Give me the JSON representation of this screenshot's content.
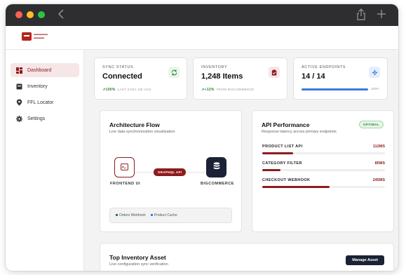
{
  "sidebar": {
    "items": [
      {
        "label": "Dashboard",
        "icon": "dashboard-icon",
        "active": true
      },
      {
        "label": "Inventory",
        "icon": "inventory-icon",
        "active": false
      },
      {
        "label": "FFL Locator",
        "icon": "location-pin-icon",
        "active": false
      },
      {
        "label": "Settings",
        "icon": "gear-icon",
        "active": false
      }
    ]
  },
  "stats": [
    {
      "label": "SYNC STATUS",
      "value": "Connected",
      "trend": "100%",
      "foot": "LAST SYNC 2M AGO",
      "icon": "sync-icon"
    },
    {
      "label": "INVENTORY",
      "value": "1,248 Items",
      "trend": "+12%",
      "foot": "FROM BIGCOMMERCE",
      "icon": "clipboard-icon"
    },
    {
      "label": "ACTIVE ENDPOINTS",
      "value": "14 / 14",
      "progress": 1.0,
      "progress_label": "100%",
      "icon": "endpoints-icon"
    }
  ],
  "architecture": {
    "title": "Architecture Flow",
    "subtitle": "Live data synchronization visualization",
    "left_node": "FRONTEND UI",
    "connector": "GRAPHQL API",
    "right_node": "BIGCOMMERCE",
    "legend": [
      "Orders Webhook",
      "Product Cache"
    ]
  },
  "api": {
    "title": "API Performance",
    "badge": "OPTIMAL",
    "subtitle": "Response latency across primary endpoints",
    "rows": [
      {
        "name": "PRODUCT LIST API",
        "ms": "112MS",
        "fill": 0.25
      },
      {
        "name": "CATEGORY FILTER",
        "ms": "85MS",
        "fill": 0.15
      },
      {
        "name": "CHECKOUT WEBHOOK",
        "ms": "245MS",
        "fill": 0.55
      }
    ]
  },
  "asset": {
    "title": "Top Inventory Asset",
    "subtitle": "Live configuration sync verification",
    "button": "Manage Asset"
  },
  "colors": {
    "accent": "#8d1b1d",
    "success": "#2e7d32",
    "blue": "#3b7bdc",
    "dark": "#1c2235"
  }
}
